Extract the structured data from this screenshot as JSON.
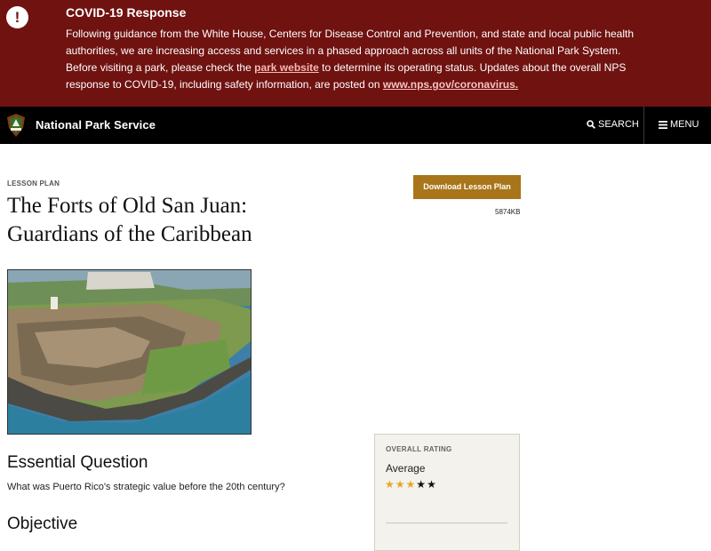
{
  "alert": {
    "icon": "exclamation-icon",
    "title": "COVID-19 Response",
    "body_part1": "Following guidance from the White House, Centers for Disease Control and Prevention, and state and local public health authorities, we are increasing access and services in a phased approach across all units of the National Park System. Before visiting a park, please check the ",
    "link1": "park website",
    "body_part2": " to determine its operating status. Updates about the overall NPS response to COVID-19, including safety information, are posted on ",
    "link2": "www.nps.gov/coronavirus.",
    "colors": {
      "background": "#6f1210",
      "link": "#f5b9b4"
    }
  },
  "navbar": {
    "logo": "nps-arrowhead-logo",
    "brand": "National Park Service",
    "search_label": "SEARCH",
    "menu_label": "MENU"
  },
  "page": {
    "eyebrow": "LESSON PLAN",
    "title_line1": "The Forts of Old San Juan:",
    "title_line2": "Guardians of the Caribbean",
    "download_label": "Download Lesson Plan",
    "file_size": "5874KB",
    "image_alt": "aerial-photo-of-fort",
    "essential_question_heading": "Essential Question",
    "essential_question_text": "What was Puerto Rico's strategic value before the 20th century?",
    "objective_heading": "Objective"
  },
  "rating": {
    "label": "OVERALL RATING",
    "value_text": "Average",
    "stars_filled": 3,
    "stars_total": 5,
    "colors": {
      "filled": "#e8a52c",
      "empty": "#111111"
    }
  }
}
